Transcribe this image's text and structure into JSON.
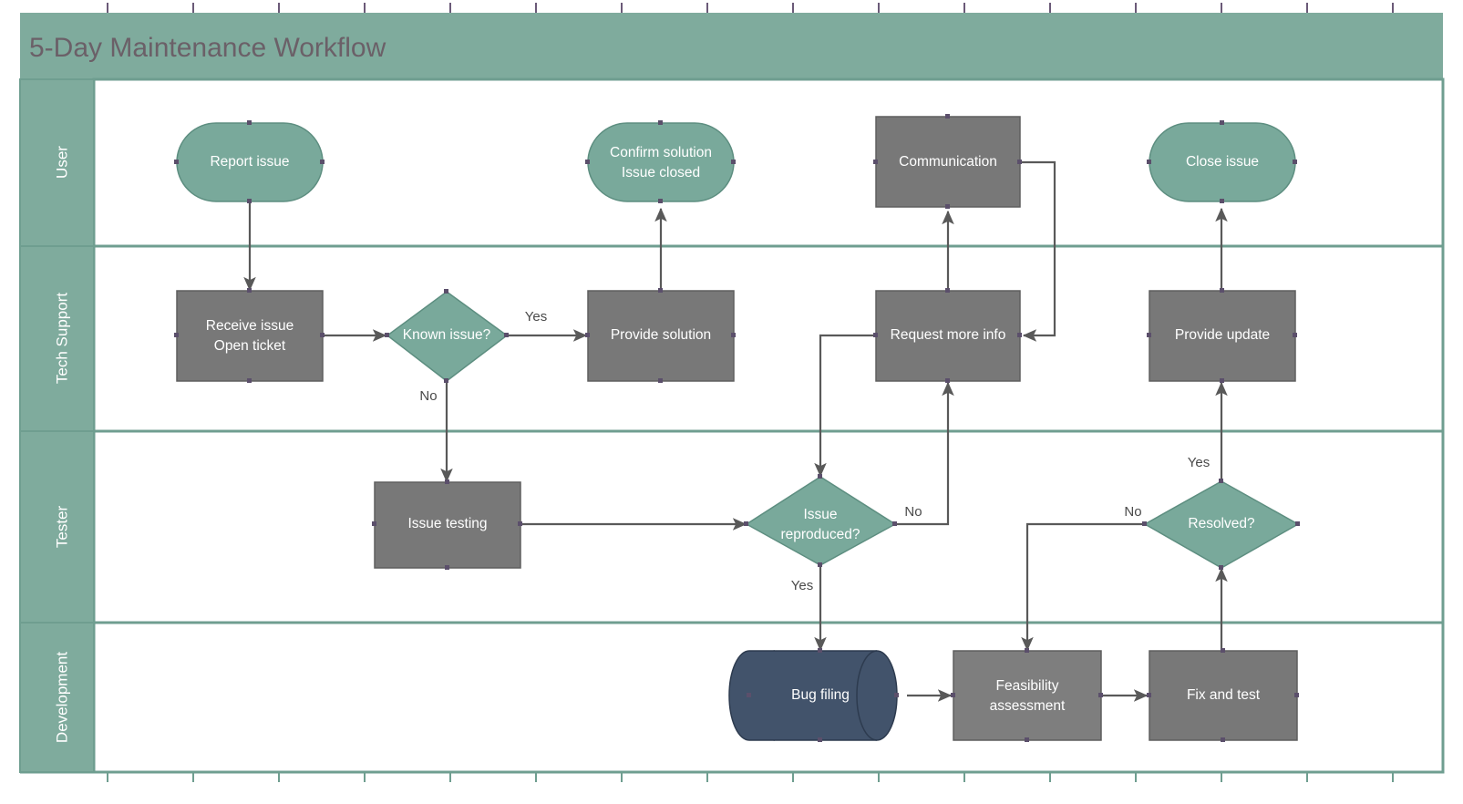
{
  "pool": {
    "title": "5-Day Maintenance Workflow",
    "title_color": "#7a7078",
    "header_fill": "#7fab9d",
    "lane_border": "#6f9e90",
    "canvas_bg": "#ffffff"
  },
  "colors": {
    "accent_green": "#79a99b",
    "process_gray": "#787878",
    "data_navy": "#42536b",
    "edge_stroke": "#595959",
    "text_white": "#ffffff"
  },
  "lanes": [
    {
      "id": "user",
      "label": "User"
    },
    {
      "id": "tech-support",
      "label": "Tech Support"
    },
    {
      "id": "tester",
      "label": "Tester"
    },
    {
      "id": "development",
      "label": "Development"
    }
  ],
  "nodes": [
    {
      "id": "report-issue",
      "label": "Report issue",
      "lane": "user",
      "shape": "terminator",
      "fill": "accent_green"
    },
    {
      "id": "confirm-solution",
      "label": "Confirm solution\nIssue closed",
      "lane": "user",
      "shape": "terminator",
      "fill": "accent_green"
    },
    {
      "id": "communication",
      "label": "Communication",
      "lane": "user",
      "shape": "process",
      "fill": "process_gray"
    },
    {
      "id": "close-issue",
      "label": "Close issue",
      "lane": "user",
      "shape": "terminator",
      "fill": "accent_green"
    },
    {
      "id": "receive-issue",
      "label": "Receive issue\nOpen ticket",
      "lane": "tech-support",
      "shape": "process",
      "fill": "process_gray"
    },
    {
      "id": "known-issue",
      "label": "Known issue?",
      "lane": "tech-support",
      "shape": "decision",
      "fill": "accent_green"
    },
    {
      "id": "provide-solution",
      "label": "Provide solution",
      "lane": "tech-support",
      "shape": "process",
      "fill": "process_gray"
    },
    {
      "id": "request-more-info",
      "label": "Request more info",
      "lane": "tech-support",
      "shape": "process",
      "fill": "process_gray"
    },
    {
      "id": "provide-update",
      "label": "Provide update",
      "lane": "tech-support",
      "shape": "process",
      "fill": "process_gray"
    },
    {
      "id": "issue-testing",
      "label": "Issue testing",
      "lane": "tester",
      "shape": "process",
      "fill": "process_gray"
    },
    {
      "id": "issue-reproduced",
      "label": "Issue\nreproduced?",
      "lane": "tester",
      "shape": "decision",
      "fill": "accent_green"
    },
    {
      "id": "resolved",
      "label": "Resolved?",
      "lane": "tester",
      "shape": "decision",
      "fill": "accent_green"
    },
    {
      "id": "bug-filing",
      "label": "Bug filing",
      "lane": "development",
      "shape": "database",
      "fill": "data_navy"
    },
    {
      "id": "feasibility-assessment",
      "label": "Feasibility\nassessment",
      "lane": "development",
      "shape": "process",
      "fill": "process_gray"
    },
    {
      "id": "fix-and-test",
      "label": "Fix and test",
      "lane": "development",
      "shape": "process",
      "fill": "process_gray"
    }
  ],
  "node_text": {
    "report-issue": "Report issue",
    "confirm-solution-1": "Confirm solution",
    "confirm-solution-2": "Issue closed",
    "communication": "Communication",
    "close-issue": "Close issue",
    "receive-issue-1": "Receive issue",
    "receive-issue-2": "Open ticket",
    "known-issue": "Known issue?",
    "provide-solution": "Provide solution",
    "request-more-info": "Request more info",
    "provide-update": "Provide update",
    "issue-testing": "Issue testing",
    "issue-reproduced-1": "Issue",
    "issue-reproduced-2": "reproduced?",
    "resolved": "Resolved?",
    "bug-filing": "Bug filing",
    "feasibility-1": "Feasibility",
    "feasibility-2": "assessment",
    "fix-and-test": "Fix and test"
  },
  "edges": [
    {
      "id": "e-report-receive",
      "from": "report-issue",
      "to": "receive-issue",
      "label": ""
    },
    {
      "id": "e-receive-known",
      "from": "receive-issue",
      "to": "known-issue",
      "label": ""
    },
    {
      "id": "e-known-yes",
      "from": "known-issue",
      "to": "provide-solution",
      "label": "Yes"
    },
    {
      "id": "e-known-no",
      "from": "known-issue",
      "to": "issue-testing",
      "label": "No"
    },
    {
      "id": "e-solution-confirm",
      "from": "provide-solution",
      "to": "confirm-solution",
      "label": ""
    },
    {
      "id": "e-testing-reproduced",
      "from": "issue-testing",
      "to": "issue-reproduced",
      "label": ""
    },
    {
      "id": "e-reproduced-no",
      "from": "issue-reproduced",
      "to": "request-more-info",
      "label": "No"
    },
    {
      "id": "e-reproduced-yes",
      "from": "issue-reproduced",
      "to": "bug-filing",
      "label": "Yes"
    },
    {
      "id": "e-requestinfo-comm",
      "from": "request-more-info",
      "to": "communication",
      "label": ""
    },
    {
      "id": "e-comm-requestinfo",
      "from": "communication",
      "to": "request-more-info",
      "label": ""
    },
    {
      "id": "e-requestinfo-reproduced",
      "from": "request-more-info",
      "to": "issue-reproduced",
      "label": ""
    },
    {
      "id": "e-bug-feasibility",
      "from": "bug-filing",
      "to": "feasibility-assessment",
      "label": ""
    },
    {
      "id": "e-feasibility-fix",
      "from": "feasibility-assessment",
      "to": "fix-and-test",
      "label": ""
    },
    {
      "id": "e-fix-resolved",
      "from": "fix-and-test",
      "to": "resolved",
      "label": ""
    },
    {
      "id": "e-resolved-no",
      "from": "resolved",
      "to": "feasibility-assessment",
      "label": "No"
    },
    {
      "id": "e-resolved-yes",
      "from": "resolved",
      "to": "provide-update",
      "label": "Yes"
    },
    {
      "id": "e-update-close",
      "from": "provide-update",
      "to": "close-issue",
      "label": ""
    }
  ],
  "edge_labels": {
    "known-yes": "Yes",
    "known-no": "No",
    "reproduced-no": "No",
    "reproduced-yes": "Yes",
    "resolved-no": "No",
    "resolved-yes": "Yes"
  }
}
